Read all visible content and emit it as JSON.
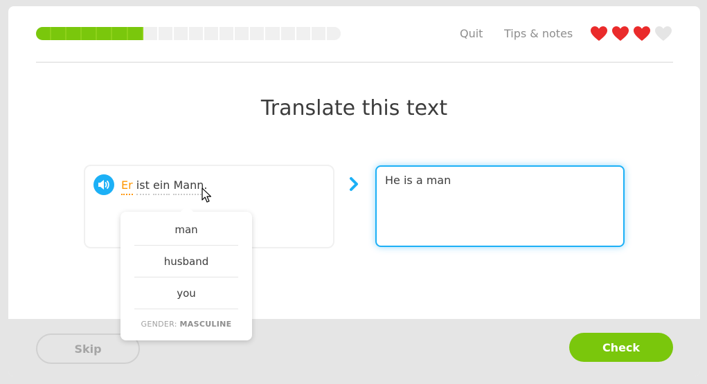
{
  "header": {
    "progress": {
      "segments": 20,
      "completed": 7,
      "fraction": 0.35
    },
    "quit_label": "Quit",
    "tips_label": "Tips & notes",
    "hearts": {
      "total": 4,
      "filled": 3,
      "color": "#ea2b2b",
      "empty_color": "#e5e5e5"
    }
  },
  "prompt": {
    "title": "Translate this text"
  },
  "source": {
    "speaker_icon": "speaker-icon",
    "words": [
      "Er",
      "ist",
      "ein",
      "Mann."
    ],
    "highlight_color": "#ff9600"
  },
  "answer": {
    "value": "He is a man"
  },
  "hint": {
    "options": [
      "man",
      "husband",
      "you"
    ],
    "gender_label": "GENDER:",
    "gender_value": "MASCULINE"
  },
  "footer": {
    "skip_label": "Skip",
    "check_label": "Check"
  },
  "colors": {
    "accent_green": "#7ac70c",
    "accent_blue": "#1cb0f6"
  }
}
